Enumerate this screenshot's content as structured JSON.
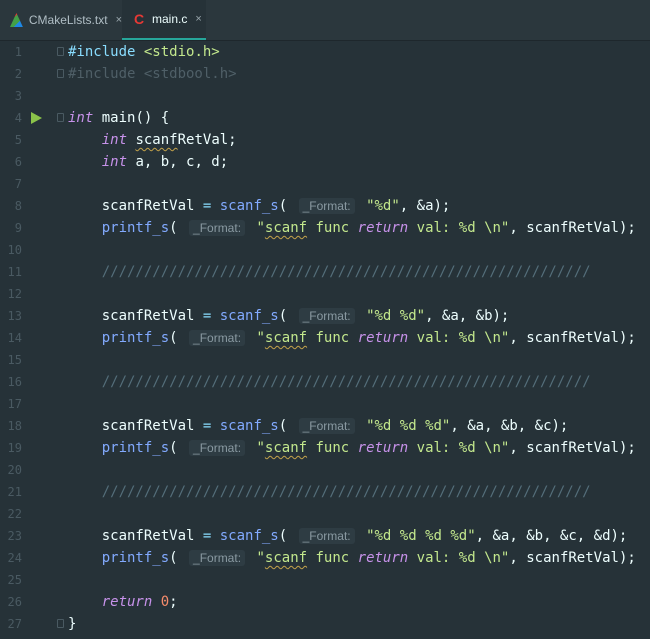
{
  "tabs": [
    {
      "label": "CMakeLists.txt",
      "icon": "cmake-icon"
    },
    {
      "label": "main.c",
      "icon": "c-file-icon"
    }
  ],
  "close_glyph": "×",
  "hint_label": "_Format:",
  "lines": [
    {
      "n": "1",
      "t": "#include <stdio.h>"
    },
    {
      "n": "2",
      "t": "#include <stdbool.h>"
    },
    {
      "n": "3",
      "t": ""
    },
    {
      "n": "4",
      "t": "int main() {"
    },
    {
      "n": "5",
      "t": "    int scanfRetVal;"
    },
    {
      "n": "6",
      "t": "    int a, b, c, d;"
    },
    {
      "n": "7",
      "t": ""
    },
    {
      "n": "8",
      "t": "    scanfRetVal = scanf_s( _Format: \"%d\", &a);"
    },
    {
      "n": "9",
      "t": "    printf_s( _Format: \"scanf func return val: %d \\n\", scanfRetVal);"
    },
    {
      "n": "10",
      "t": ""
    },
    {
      "n": "11",
      "t": "    //////////////////////////////////////////////////////////"
    },
    {
      "n": "12",
      "t": ""
    },
    {
      "n": "13",
      "t": "    scanfRetVal = scanf_s( _Format: \"%d %d\", &a, &b);"
    },
    {
      "n": "14",
      "t": "    printf_s( _Format: \"scanf func return val: %d \\n\", scanfRetVal);"
    },
    {
      "n": "15",
      "t": ""
    },
    {
      "n": "16",
      "t": "    //////////////////////////////////////////////////////////"
    },
    {
      "n": "17",
      "t": ""
    },
    {
      "n": "18",
      "t": "    scanfRetVal = scanf_s( _Format: \"%d %d %d\", &a, &b, &c);"
    },
    {
      "n": "19",
      "t": "    printf_s( _Format: \"scanf func return val: %d \\n\", scanfRetVal);"
    },
    {
      "n": "20",
      "t": ""
    },
    {
      "n": "21",
      "t": "    //////////////////////////////////////////////////////////"
    },
    {
      "n": "22",
      "t": ""
    },
    {
      "n": "23",
      "t": "    scanfRetVal = scanf_s( _Format: \"%d %d %d %d\", &a, &b, &c, &d);"
    },
    {
      "n": "24",
      "t": "    printf_s( _Format: \"scanf func return val: %d \\n\", scanfRetVal);"
    },
    {
      "n": "25",
      "t": ""
    },
    {
      "n": "26",
      "t": "    return 0;"
    },
    {
      "n": "27",
      "t": "}"
    }
  ]
}
